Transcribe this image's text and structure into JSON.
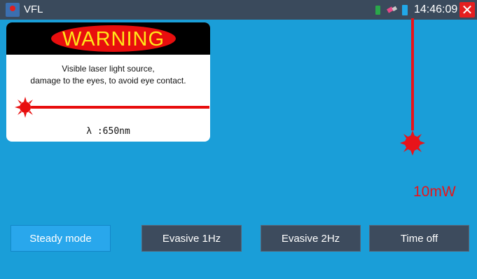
{
  "status_bar": {
    "app_title": "VFL",
    "time": "14:46:09",
    "icons": [
      "app-icon",
      "storage-indicator-icon",
      "usb-icon",
      "battery-icon",
      "close-icon"
    ],
    "close_symbol": "✕"
  },
  "warning": {
    "title": "WARNING",
    "line1": "Visible laser light source,",
    "line2": "damage to the eyes, to avoid eye contact.",
    "wavelength": "λ :650nm"
  },
  "laser": {
    "power": "10mW",
    "color": "#e8141a"
  },
  "modes": [
    {
      "label": "Steady mode",
      "active": true
    },
    {
      "label": "Evasive 1Hz",
      "active": false
    },
    {
      "label": "Evasive 2Hz",
      "active": false
    },
    {
      "label": "Time off",
      "active": false
    }
  ],
  "colors": {
    "background": "#1a9ed8",
    "status_bar": "#3a4a5c",
    "button": "#3d4b5d",
    "button_active": "#29a7ec",
    "warning_red": "#e80e0e",
    "warning_yellow": "#ffe61a"
  }
}
